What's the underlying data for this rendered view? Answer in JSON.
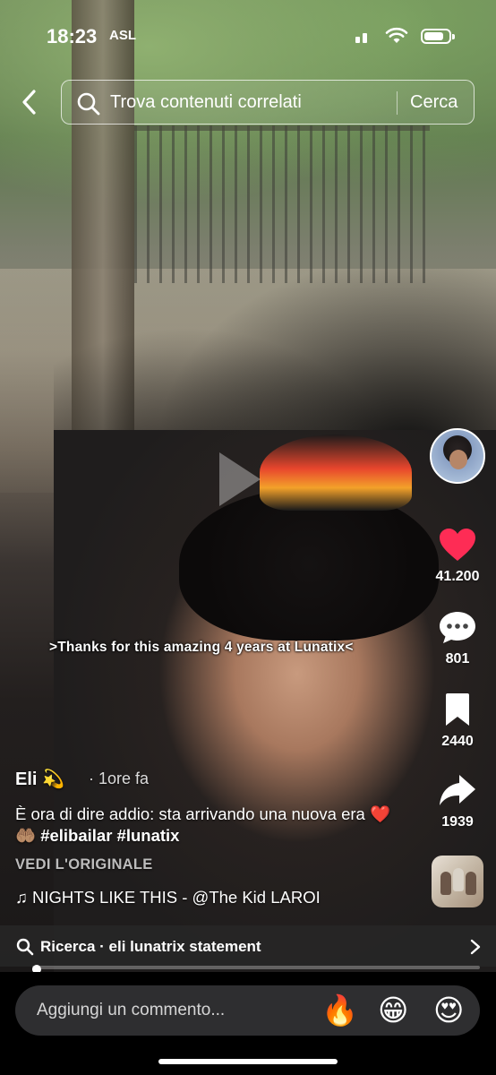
{
  "status_bar": {
    "time": "18:23",
    "accessibility_badge": "ASL",
    "signal_bars": 2,
    "battery_level": 0.8
  },
  "search_bar": {
    "placeholder": "Trova contenuti correlati",
    "button_label": "Cerca",
    "icons": {
      "back": "chevron-left-icon",
      "search": "search-icon"
    }
  },
  "video": {
    "caption_overlay": ">Thanks for this amazing 4 years at Lunatix<"
  },
  "actions": {
    "likes": "41.200",
    "comments": "801",
    "saves": "2440",
    "shares": "1939",
    "icons": [
      "heart-icon",
      "comment-icon",
      "bookmark-icon",
      "share-icon"
    ],
    "like_color": "#FE2C55"
  },
  "post": {
    "author": "Eli 💫",
    "time_ago": "· 1ore fa",
    "description": "È ora di dire addio: sta arrivando una nuova era ❤️🤲🏽",
    "hashtags": "#elibailar #lunatix",
    "see_original": "VEDI L'ORIGINALE",
    "music": "♫ NIGHTS LIKE THIS - @The Kid LAROI"
  },
  "related_search": {
    "label": "Ricerca · eli lunatrix statement"
  },
  "progress": {
    "fraction": 0.01
  },
  "comment_bar": {
    "placeholder": "Aggiungi un commento...",
    "emojis": [
      "🔥",
      "😁",
      "😍"
    ]
  }
}
